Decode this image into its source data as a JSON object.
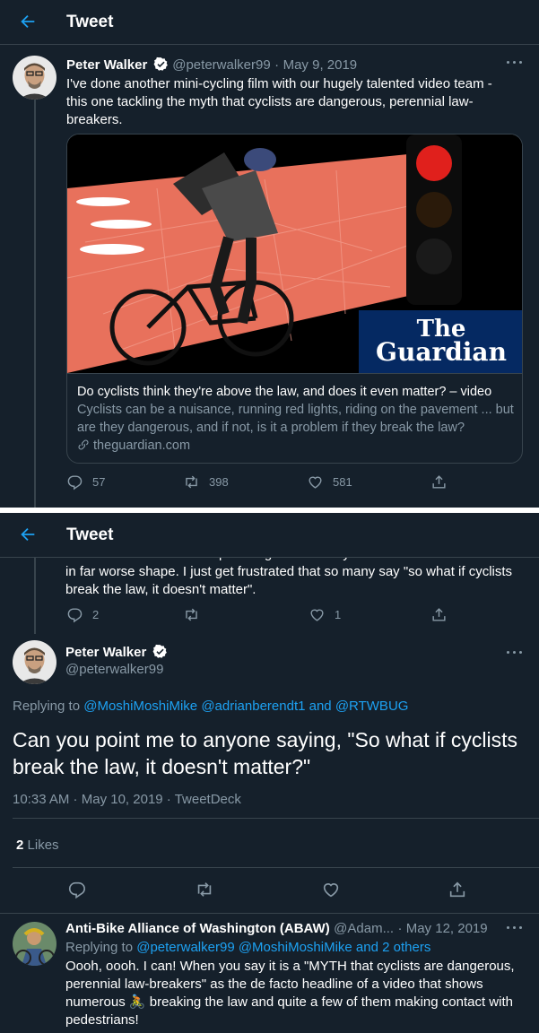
{
  "panel1": {
    "header": {
      "title": "Tweet"
    },
    "tweet": {
      "name": "Peter Walker",
      "handle": "@peterwalker99",
      "separator": "·",
      "date": "May 9, 2019",
      "text": "I've done another mini-cycling film with our hugely talented video team - this one tackling the myth that cyclists are dangerous, perennial law-breakers.",
      "card": {
        "brand_line1": "The",
        "brand_line2": "Guardian",
        "title": "Do cyclists think they're above the law, and does it even matter? – video",
        "description": "Cyclists can be a nuisance, running red lights, riding on the pavement ... but are they dangerous, and if not, is it a problem if they break the law?",
        "domain": "theguardian.com"
      },
      "replies": "57",
      "retweets": "398",
      "likes": "581"
    }
  },
  "panel2": {
    "header": {
      "title": "Tweet"
    },
    "prev_tweet": {
      "text_cut": "been knocked down on a ped Xing had been by cars instead of bikes I'd be",
      "text": "in far worse shape. I just get frustrated that so many say \"so what if cyclists break the law, it doesn't matter\".",
      "replies": "2",
      "likes": "1"
    },
    "main_tweet": {
      "name": "Peter Walker",
      "handle": "@peterwalker99",
      "replying_label": "Replying to",
      "replying_to": [
        "@MoshiMoshiMike",
        "@adrianberendt1"
      ],
      "replying_and": "and",
      "replying_last": "@RTWBUG",
      "text": "Can you point me to anyone saying, \"So what if cyclists break the law, it doesn't matter?\"",
      "time": "10:33 AM",
      "date": "May 10, 2019",
      "source": "TweetDeck",
      "likes_count": "2",
      "likes_label": "Likes"
    },
    "reply_tweet": {
      "name": "Anti-Bike Alliance of Washington (ABAW)",
      "handle": "@Adam...",
      "date": "May 12, 2019",
      "replying_label": "Replying to",
      "replying_to": "@peterwalker99 @MoshiMoshiMike and 2 others",
      "text_before": "Oooh, oooh. I can! When you say it is a \"MYTH that cyclists are dangerous, perennial law-breakers\" as the de facto headline of a video that shows numerous",
      "emoji": "🚴",
      "text_after": "breaking the law and quite a few of them making contact with pedestrians!"
    }
  },
  "colors": {
    "background": "#15202b",
    "border": "#38444d",
    "accent": "#1da1f2",
    "muted": "#8899a6",
    "text": "#ffffff"
  },
  "icons": [
    "back-arrow-icon",
    "verified-badge-icon",
    "more-icon",
    "reply-icon",
    "retweet-icon",
    "like-icon",
    "share-icon",
    "link-icon"
  ]
}
